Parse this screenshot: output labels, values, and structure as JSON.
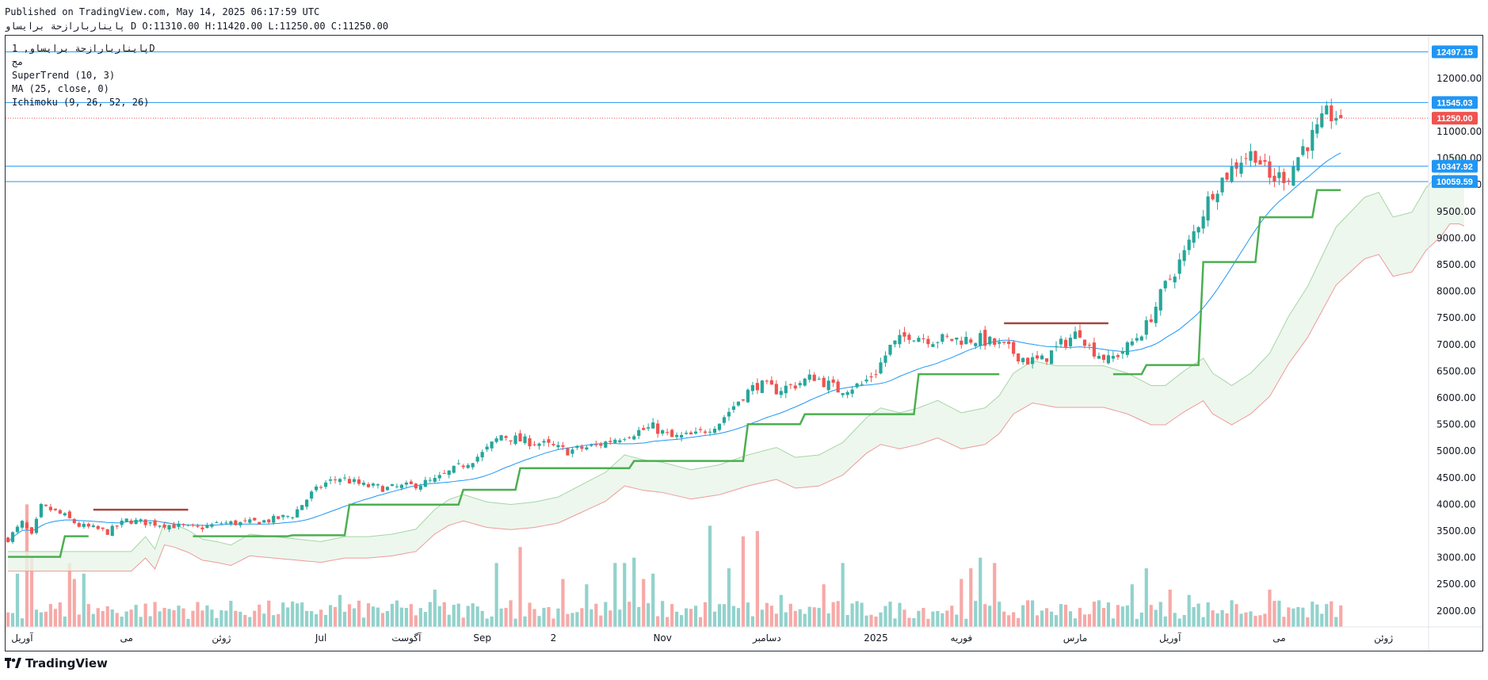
{
  "header": {
    "line1": "Published on TradingView.com, May 14, 2025 06:17:59 UTC",
    "line2": "پایناربارازحة برایساو D O:11310.00 H:11420.00 L:11250.00 C:11250.00"
  },
  "legend": {
    "symbol": "پایناربارازحة برایساو, 1D",
    "sub": "مج",
    "indicators": [
      "SuperTrend (10, 3)",
      "MA (25, close, 0)",
      "Ichimoku (9, 26, 52, 26)"
    ]
  },
  "branding": {
    "text": "TradingView"
  },
  "colors": {
    "up": "#26a69a",
    "down": "#ef5350",
    "ma": "#2196f3",
    "supertrend_up": "#4caf50",
    "supertrend_down": "#a94442",
    "cloud_fill": "#e8f5e9",
    "cloud_line_up": "#a5d6a7",
    "cloud_line_down": "#ef9a9a",
    "hline": "#2196f3",
    "last_price": "#ef5350"
  },
  "chart_data": {
    "type": "candlestick",
    "ylim": [
      1700,
      12800
    ],
    "price_ticks": [
      2000,
      2500,
      3000,
      3500,
      4000,
      4500,
      5000,
      5500,
      6000,
      6500,
      7000,
      7500,
      8000,
      8500,
      9000,
      9500,
      10000,
      10500,
      11000,
      12000
    ],
    "price_tick_labels": [
      "2000.00",
      "2500.00",
      "3000.00",
      "3500.00",
      "4000.00",
      "4500.00",
      "5000.00",
      "5500.00",
      "6000.00",
      "6500.00",
      "7000.00",
      "7500.00",
      "8000.00",
      "8500.00",
      "9000.00",
      "9500.00",
      "10000.00",
      "10500.00",
      "11000.00",
      "12000.00"
    ],
    "time_labels": [
      {
        "text": "آوریل",
        "i": 3
      },
      {
        "text": "می",
        "i": 25
      },
      {
        "text": "ژوئن",
        "i": 45
      },
      {
        "text": "Jul",
        "i": 66
      },
      {
        "text": "آگوست",
        "i": 84
      },
      {
        "text": "Sep",
        "i": 100
      },
      {
        "text": "2",
        "i": 115
      },
      {
        "text": "Nov",
        "i": 138
      },
      {
        "text": "دسامبر",
        "i": 160
      },
      {
        "text": "2025",
        "i": 183
      },
      {
        "text": "فوریه",
        "i": 201
      },
      {
        "text": "مارس",
        "i": 225
      },
      {
        "text": "آوریل",
        "i": 245
      },
      {
        "text": "می",
        "i": 268
      },
      {
        "text": "ژوئن",
        "i": 290
      }
    ],
    "hlines": [
      {
        "value": 12497.15,
        "label": "12497.15"
      },
      {
        "value": 11545.03,
        "label": "11545.03"
      },
      {
        "value": 10347.92,
        "label": "10347.92"
      },
      {
        "value": 10059.59,
        "label": "10059.59"
      }
    ],
    "last_price": {
      "value": 11250.0,
      "label": "11250.00"
    },
    "close_keyframes": [
      [
        0,
        3350
      ],
      [
        3,
        3650
      ],
      [
        5,
        3400
      ],
      [
        7,
        3950
      ],
      [
        9,
        3900
      ],
      [
        12,
        3780
      ],
      [
        15,
        3600
      ],
      [
        18,
        3550
      ],
      [
        21,
        3480
      ],
      [
        25,
        3700
      ],
      [
        30,
        3650
      ],
      [
        35,
        3600
      ],
      [
        40,
        3550
      ],
      [
        45,
        3650
      ],
      [
        50,
        3650
      ],
      [
        55,
        3700
      ],
      [
        60,
        3800
      ],
      [
        64,
        4200
      ],
      [
        67,
        4400
      ],
      [
        70,
        4500
      ],
      [
        75,
        4350
      ],
      [
        80,
        4300
      ],
      [
        85,
        4350
      ],
      [
        90,
        4450
      ],
      [
        95,
        4700
      ],
      [
        100,
        4950
      ],
      [
        104,
        5300
      ],
      [
        108,
        5200
      ],
      [
        112,
        5150
      ],
      [
        118,
        5000
      ],
      [
        124,
        5100
      ],
      [
        130,
        5300
      ],
      [
        136,
        5450
      ],
      [
        140,
        5250
      ],
      [
        145,
        5300
      ],
      [
        150,
        5550
      ],
      [
        155,
        6050
      ],
      [
        158,
        6250
      ],
      [
        162,
        6150
      ],
      [
        166,
        6250
      ],
      [
        170,
        6400
      ],
      [
        175,
        6150
      ],
      [
        180,
        6250
      ],
      [
        183,
        6500
      ],
      [
        186,
        6950
      ],
      [
        190,
        7200
      ],
      [
        195,
        7100
      ],
      [
        200,
        7100
      ],
      [
        205,
        7100
      ],
      [
        210,
        6950
      ],
      [
        215,
        6700
      ],
      [
        218,
        6700
      ],
      [
        222,
        7000
      ],
      [
        226,
        7250
      ],
      [
        228,
        6950
      ],
      [
        232,
        6700
      ],
      [
        236,
        6950
      ],
      [
        240,
        7350
      ],
      [
        244,
        8100
      ],
      [
        248,
        8700
      ],
      [
        252,
        9500
      ],
      [
        254,
        9900
      ],
      [
        257,
        10200
      ],
      [
        260,
        10500
      ],
      [
        263,
        10600
      ],
      [
        266,
        10100
      ],
      [
        270,
        10200
      ],
      [
        273,
        10700
      ],
      [
        276,
        11000
      ],
      [
        278,
        11300
      ],
      [
        280,
        11300
      ],
      [
        281,
        11250
      ]
    ],
    "volume_spikes": [
      [
        2,
        2700
      ],
      [
        4,
        4000
      ],
      [
        5,
        3000
      ],
      [
        13,
        2900
      ],
      [
        14,
        2600
      ],
      [
        16,
        2700
      ],
      [
        36,
        2100
      ],
      [
        63,
        2000
      ],
      [
        70,
        2300
      ],
      [
        90,
        2400
      ],
      [
        100,
        2000
      ],
      [
        103,
        2900
      ],
      [
        106,
        2200
      ],
      [
        108,
        3200
      ],
      [
        117,
        2600
      ],
      [
        122,
        2500
      ],
      [
        128,
        2900
      ],
      [
        130,
        2900
      ],
      [
        132,
        3000
      ],
      [
        134,
        2600
      ],
      [
        136,
        2700
      ],
      [
        148,
        3600
      ],
      [
        152,
        2800
      ],
      [
        155,
        3400
      ],
      [
        158,
        3500
      ],
      [
        163,
        2300
      ],
      [
        166,
        2000
      ],
      [
        172,
        2500
      ],
      [
        176,
        2900
      ],
      [
        201,
        2600
      ],
      [
        203,
        2800
      ],
      [
        205,
        3000
      ],
      [
        208,
        2900
      ],
      [
        230,
        2200
      ],
      [
        237,
        2500
      ],
      [
        240,
        2800
      ],
      [
        245,
        2400
      ],
      [
        249,
        2300
      ],
      [
        258,
        2200
      ],
      [
        266,
        2400
      ]
    ],
    "volume_axis": {
      "base": 1700,
      "scale": 0.085
    }
  }
}
